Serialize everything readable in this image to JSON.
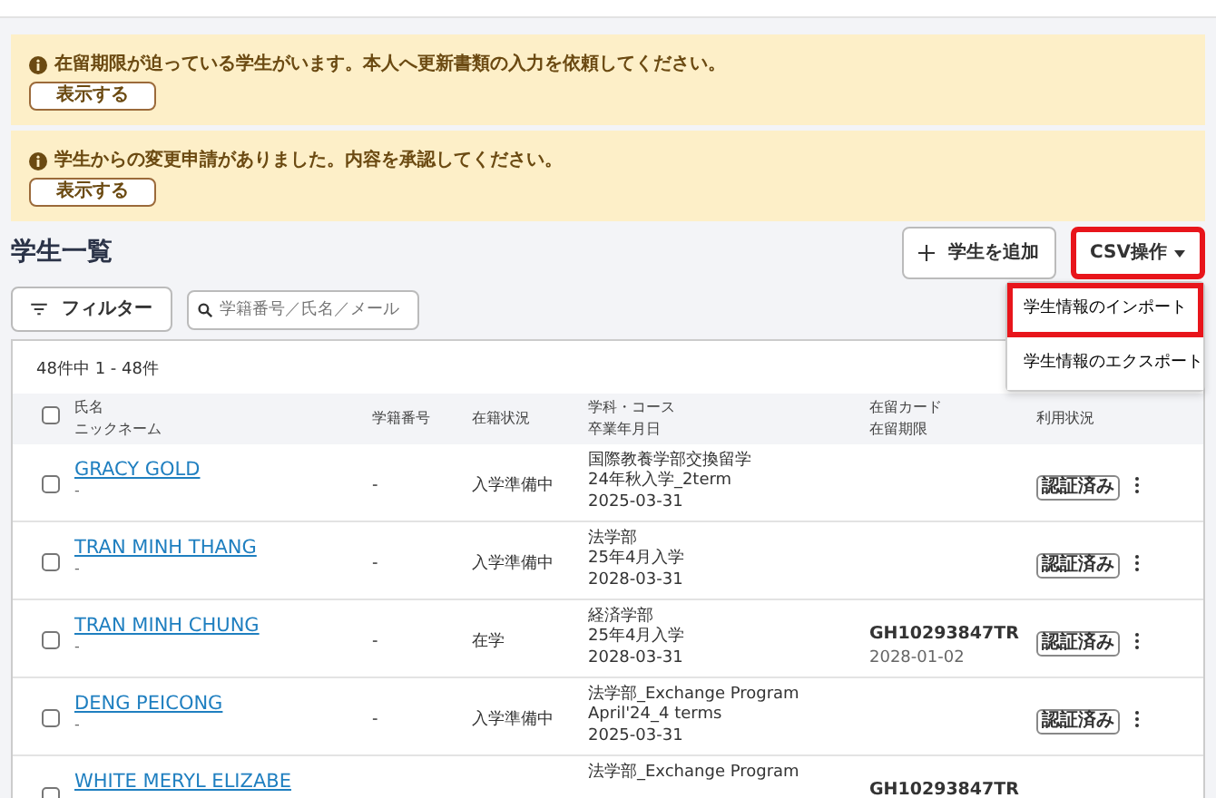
{
  "alerts": [
    {
      "message": "在留期限が迫っている学生がいます。本人へ更新書類の入力を依頼してください。",
      "button": "表示する"
    },
    {
      "message": "学生からの変更申請がありました。内容を承認してください。",
      "button": "表示する"
    }
  ],
  "page_title": "学生一覧",
  "add_button": "学生を追加",
  "csv_button": {
    "label": "CSV操作",
    "highlighted": true,
    "expanded": true
  },
  "csv_menu": [
    {
      "label": "学生情報のインポート",
      "highlighted": true
    },
    {
      "label": "学生情報のエクスポート",
      "highlighted": false
    }
  ],
  "filter_button": "フィルター",
  "search": {
    "placeholder": "学籍番号／氏名／メール"
  },
  "count": "48件中 1 - 48件",
  "all_selected": false,
  "columns": [
    {
      "lines": [
        "氏名",
        "ニックネーム"
      ]
    },
    {
      "lines": [
        "学籍番号"
      ]
    },
    {
      "lines": [
        "在籍状況"
      ]
    },
    {
      "lines": [
        "学科・コース",
        "卒業年月日"
      ]
    },
    {
      "lines": [
        "在留カード",
        "在留期限"
      ]
    },
    {
      "lines": [
        "利用状況"
      ]
    }
  ],
  "rows": [
    {
      "checked": false,
      "name": "GRACY GOLD",
      "nickname": "-",
      "student_id": "-",
      "status": "入学準備中",
      "course": [
        "国際教養学部交換留学",
        "24年秋入学_2term",
        "2025-03-31"
      ],
      "card": "",
      "card_expiry": "",
      "usage": "認証済み"
    },
    {
      "checked": false,
      "name": "TRAN MINH THANG",
      "nickname": "-",
      "student_id": "-",
      "status": "入学準備中",
      "course": [
        "法学部",
        "25年4月入学",
        "2028-03-31"
      ],
      "card": "",
      "card_expiry": "",
      "usage": "認証済み"
    },
    {
      "checked": false,
      "name": "TRAN MINH CHUNG",
      "nickname": "-",
      "student_id": "-",
      "status": "在学",
      "course": [
        "経済学部",
        "25年4月入学",
        "2028-03-31"
      ],
      "card": "GH10293847TR",
      "card_expiry": "2028-01-02",
      "usage": "認証済み"
    },
    {
      "checked": false,
      "name": "DENG PEICONG",
      "nickname": "-",
      "student_id": "-",
      "status": "入学準備中",
      "course": [
        "法学部_Exchange Program",
        "April'24_4 terms",
        "2025-03-31"
      ],
      "card": "",
      "card_expiry": "",
      "usage": "認証済み"
    },
    {
      "checked": false,
      "name": "WHITE MERYL ELIZABE",
      "nickname": "",
      "student_id": "",
      "status": "",
      "course": [
        "法学部_Exchange Program"
      ],
      "card": "GH10293847TR",
      "card_expiry": "",
      "usage": ""
    }
  ]
}
